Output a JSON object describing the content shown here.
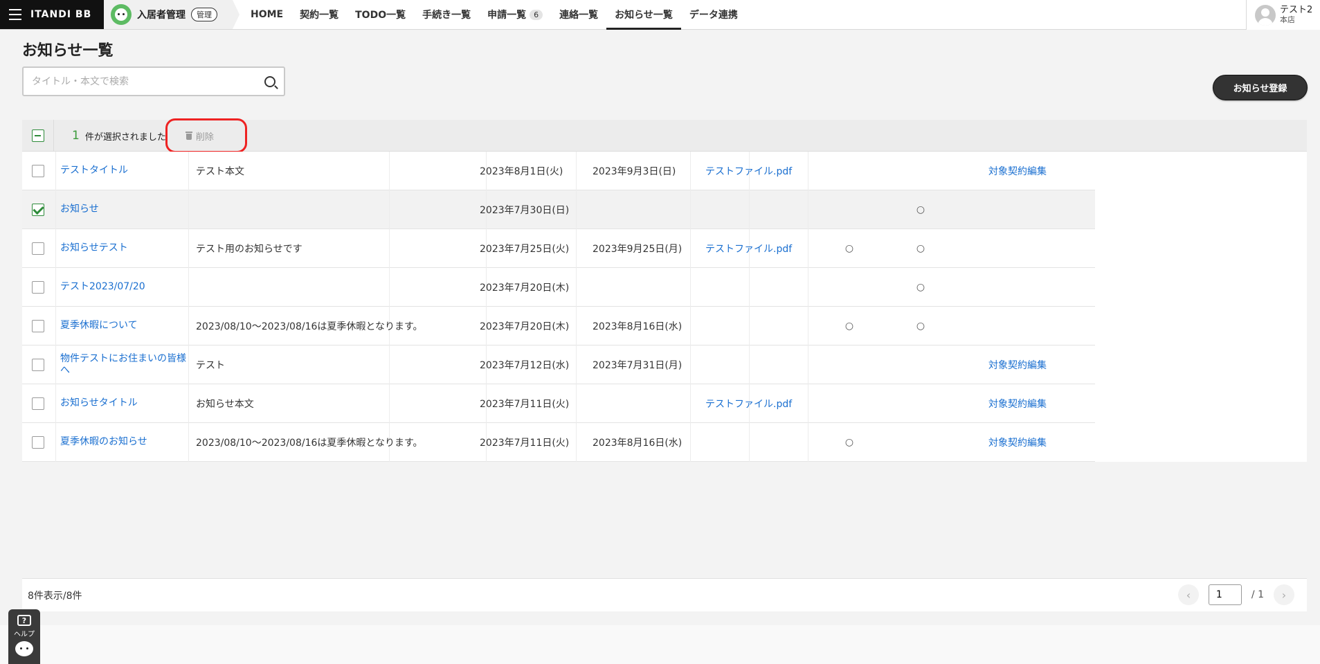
{
  "header": {
    "logo": "ITANDI BB",
    "app_name": "入居者管理",
    "app_badge": "管理",
    "nav": [
      {
        "label": "HOME"
      },
      {
        "label": "契約一覧"
      },
      {
        "label": "TODO一覧"
      },
      {
        "label": "手続き一覧"
      },
      {
        "label": "申請一覧",
        "count": "6"
      },
      {
        "label": "連絡一覧"
      },
      {
        "label": "お知らせ一覧",
        "active": true
      },
      {
        "label": "データ連携"
      }
    ],
    "user": {
      "name": "テスト2",
      "branch": "本店"
    }
  },
  "page": {
    "title": "お知らせ一覧",
    "search_placeholder": "タイトル・本文で検索",
    "register_label": "お知らせ登録"
  },
  "selection": {
    "count": "1",
    "text": "件が選択されました",
    "delete_label": "削除"
  },
  "rows": [
    {
      "checked": false,
      "title": "テストタイトル",
      "body": "テスト本文",
      "start": "2023年8月1日(火)",
      "end": "2023年9月3日(日)",
      "file": "テストファイル.pdf",
      "mark1": "",
      "mark2": "",
      "edit": "対象契約編集"
    },
    {
      "checked": true,
      "title": "お知らせ",
      "body": "",
      "start": "2023年7月30日(日)",
      "end": "",
      "file": "",
      "mark1": "",
      "mark2": "○",
      "edit": ""
    },
    {
      "checked": false,
      "title": "お知らせテスト",
      "body": "テスト用のお知らせです",
      "start": "2023年7月25日(火)",
      "end": "2023年9月25日(月)",
      "file": "テストファイル.pdf",
      "mark1": "○",
      "mark2": "○",
      "edit": ""
    },
    {
      "checked": false,
      "title": "テスト2023/07/20",
      "body": "",
      "start": "2023年7月20日(木)",
      "end": "",
      "file": "",
      "mark1": "",
      "mark2": "○",
      "edit": ""
    },
    {
      "checked": false,
      "title": "夏季休暇について",
      "body": "2023/08/10〜2023/08/16は夏季休暇となります。",
      "start": "2023年7月20日(木)",
      "end": "2023年8月16日(水)",
      "file": "",
      "mark1": "○",
      "mark2": "○",
      "edit": ""
    },
    {
      "checked": false,
      "title": "物件テストにお住まいの皆様へ",
      "body": "テスト",
      "start": "2023年7月12日(水)",
      "end": "2023年7月31日(月)",
      "file": "",
      "mark1": "",
      "mark2": "",
      "edit": "対象契約編集"
    },
    {
      "checked": false,
      "title": "お知らせタイトル",
      "body": "お知らせ本文",
      "start": "2023年7月11日(火)",
      "end": "",
      "file": "テストファイル.pdf",
      "mark1": "",
      "mark2": "",
      "edit": "対象契約編集"
    },
    {
      "checked": false,
      "title": "夏季休暇のお知らせ",
      "body": "2023/08/10〜2023/08/16は夏季休暇となります。",
      "start": "2023年7月11日(火)",
      "end": "2023年8月16日(水)",
      "file": "",
      "mark1": "○",
      "mark2": "",
      "edit": "対象契約編集"
    }
  ],
  "footer": {
    "count_text": "8件表示/8件",
    "current_page": "1",
    "total_pages": "/ 1",
    "prev_icon": "chevron-left-icon",
    "next_icon": "chevron-right-icon"
  },
  "help": {
    "label": "ヘルプ",
    "icon_text": "?"
  },
  "colors": {
    "accent_green": "#2e8b3a",
    "link_blue": "#1a6fd0",
    "highlight_red": "#e22222"
  }
}
